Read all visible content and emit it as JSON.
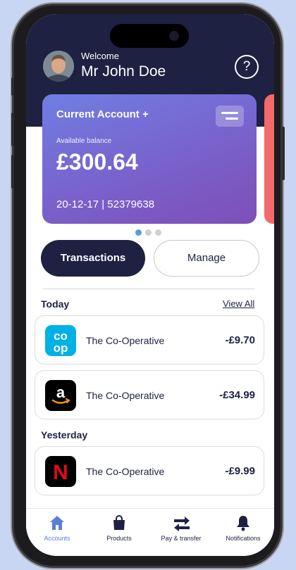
{
  "header": {
    "welcome_label": "Welcome",
    "user_name": "Mr John Doe",
    "help_symbol": "?"
  },
  "account_card": {
    "title": "Current Account +",
    "balance_label": "Available balance",
    "balance": "£300.64",
    "sort_code": "20-12-17",
    "separator": "|",
    "account_number": "52379638",
    "pager_dots": 3,
    "active_dot": 0
  },
  "actions": {
    "transactions_label": "Transactions",
    "manage_label": "Manage"
  },
  "transactions": {
    "view_all_label": "View All",
    "groups": [
      {
        "label": "Today",
        "items": [
          {
            "merchant": "The Co-Operative",
            "amount": "-£9.70",
            "logo": "coop-logo"
          },
          {
            "merchant": "The Co-Operative",
            "amount": "-£34.99",
            "logo": "amazon-logo"
          }
        ]
      },
      {
        "label": "Yesterday",
        "items": [
          {
            "merchant": "The Co-Operative",
            "amount": "-£9.99",
            "logo": "netflix-logo"
          }
        ]
      }
    ]
  },
  "logos": {
    "coop_text_top": "co",
    "coop_text_bottom": "op",
    "amazon_letter": "a",
    "netflix_letter": "N"
  },
  "tabbar": {
    "tabs": [
      {
        "label": "Accounts",
        "icon": "home-icon",
        "active": true
      },
      {
        "label": "Products",
        "icon": "shopping-bag-icon",
        "active": false
      },
      {
        "label": "Pay & transfer",
        "icon": "transfer-arrows-icon",
        "active": false
      },
      {
        "label": "Notifications",
        "icon": "bell-icon",
        "active": false
      }
    ]
  },
  "colors": {
    "navy": "#1e2142",
    "accent_blue": "#5a7fd6",
    "card_gradient_start": "#6f7ee3",
    "card_gradient_end": "#7e4fb8",
    "background": "#c9d6f3",
    "coop_blue": "#00b1e7",
    "netflix_red": "#e50914"
  }
}
